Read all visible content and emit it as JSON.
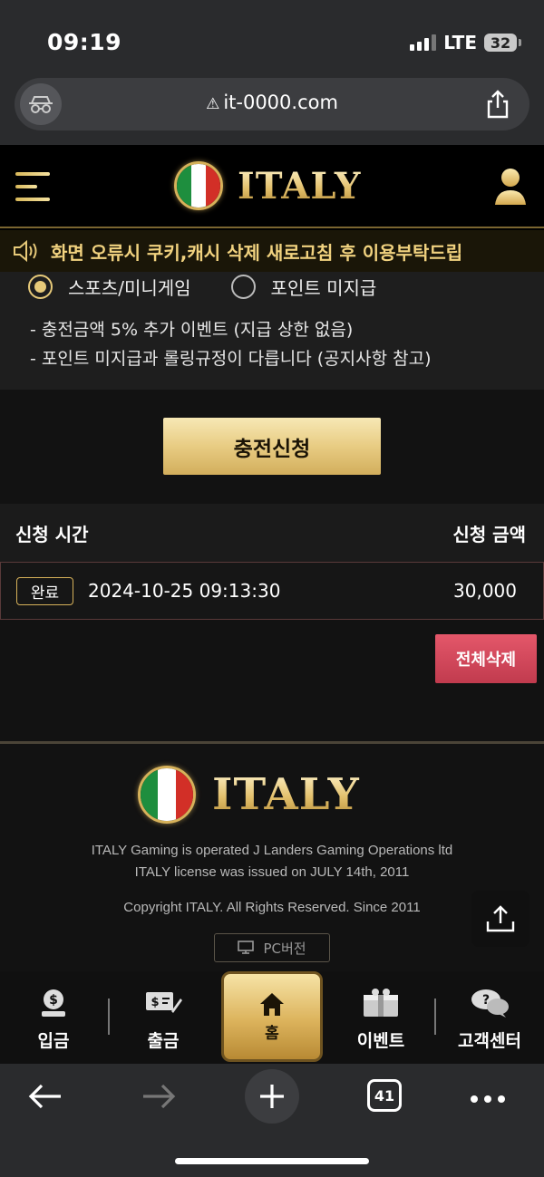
{
  "status_bar": {
    "time": "09:19",
    "network": "LTE",
    "battery": "32"
  },
  "browser": {
    "url": "it-0000.com",
    "tabs_count": "41"
  },
  "header": {
    "logo_text": "ITALY"
  },
  "notice": {
    "text": "화면 오류시 쿠키,캐시 삭제 새로고침 후 이용부탁드립"
  },
  "bonus_options": {
    "options": [
      {
        "label": "스포츠/미니게임",
        "selected": true
      },
      {
        "label": "포인트 미지급",
        "selected": false
      }
    ],
    "notes": [
      "- 충전금액 5% 추가 이벤트 (지급 상한 없음)",
      "- 포인트 미지급과 롤링규정이 다릅니다 (공지사항 참고)"
    ]
  },
  "apply_button": "충전신청",
  "history": {
    "col_time": "신청 시간",
    "col_amount": "신청 금액",
    "rows": [
      {
        "status": "완료",
        "time": "2024-10-25 09:13:30",
        "amount": "30,000"
      }
    ],
    "delete_all": "전체삭제"
  },
  "footer": {
    "logo_text": "ITALY",
    "line1": "ITALY Gaming is operated J Landers Gaming Operations ltd",
    "line2": "ITALY license was issued on JULY 14th, 2011",
    "copyright": "Copyright ITALY. All Rights Reserved. Since 2011",
    "pc_version": "PC버전"
  },
  "bottom_nav": {
    "deposit": "입금",
    "withdraw": "출금",
    "home": "홈",
    "event": "이벤트",
    "support": "고객센터"
  },
  "colors": {
    "gold": "#e6c979",
    "danger": "#d54a5d",
    "background": "#121212"
  }
}
